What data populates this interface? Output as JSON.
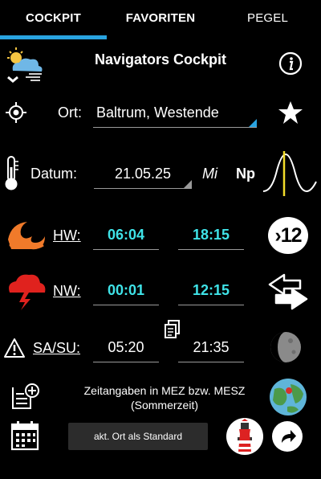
{
  "tabs": [
    {
      "label": "COCKPIT"
    },
    {
      "label": "FAVORITEN"
    },
    {
      "label": "PEGEL"
    }
  ],
  "header": {
    "title": "Navigators Cockpit"
  },
  "location": {
    "label": "Ort:",
    "value": "Baltrum, Westende"
  },
  "date": {
    "label": "Datum:",
    "value": "21.05.25",
    "weekday": "Mi",
    "moon_phase": "Np"
  },
  "hw": {
    "label": "HW:",
    "time1": "06:04",
    "time2": "18:15"
  },
  "nw": {
    "label": "NW:",
    "time1": "00:01",
    "time2": "12:15"
  },
  "sun": {
    "label": "SA/SU:",
    "rise": "05:20",
    "set": "21:35"
  },
  "badge": {
    "text": "›12"
  },
  "info": {
    "line1": "Zeitangaben in MEZ bzw. MESZ",
    "line2": "(Sommerzeit)"
  },
  "buttons": {
    "standard_label": "akt. Ort als Standard"
  },
  "colors": {
    "accent": "#29a3e0",
    "time_cyan": "#3fe3e8",
    "wave_orange": "#f07a2a",
    "storm_red": "#e0221e"
  }
}
